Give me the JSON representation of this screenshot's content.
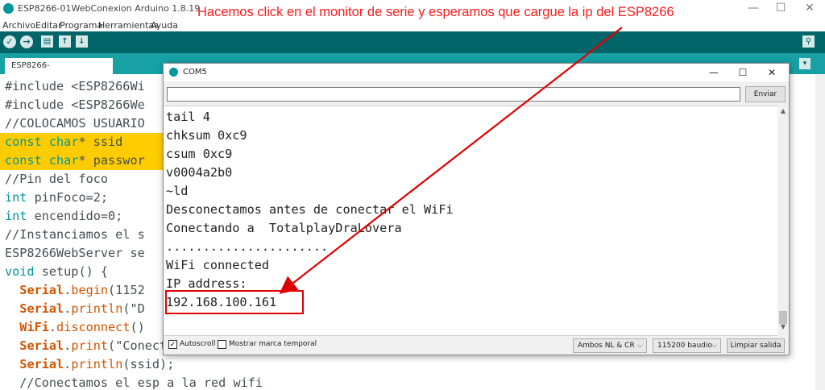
{
  "window": {
    "title": "ESP8266-01WebConexion Arduino 1.8.19"
  },
  "window_controls": {
    "minimize": "—",
    "maximize": "☐",
    "close": "✕"
  },
  "menu": [
    "Archivo",
    "Editar",
    "Programa",
    "Herramientas",
    "Ayuda"
  ],
  "toolbar": {
    "verify": "✓",
    "upload": "→",
    "new": "▤",
    "open": "↑",
    "save": "↓",
    "serial_monitor": "⚲"
  },
  "tab": {
    "label": "ESP8266-01WebConexion",
    "menu": "▾"
  },
  "code": [
    [
      {
        "t": "#include <ESP8266Wi"
      }
    ],
    [
      {
        "t": "#include <ESP8266We"
      }
    ],
    [
      {
        "t": "//COLOCAMOS USUARIO"
      }
    ],
    [
      {
        "t": "const char",
        "c": "kw-type"
      },
      {
        "t": "* ssid"
      }
    ],
    [
      {
        "t": "const char",
        "c": "kw-type"
      },
      {
        "t": "* passwor"
      }
    ],
    [
      {
        "t": "//Pin del foco"
      }
    ],
    [
      {
        "t": "int",
        "c": "kw-type"
      },
      {
        "t": " pinFoco=2;"
      }
    ],
    [
      {
        "t": "int",
        "c": "kw-type"
      },
      {
        "t": " encendido=0;"
      }
    ],
    [
      {
        "t": "//Instanciamos el s"
      }
    ],
    [
      {
        "t": "ESP8266WebServer se"
      }
    ],
    [
      {
        "t": "void",
        "c": "kw-type"
      },
      {
        "t": " setup() {"
      }
    ],
    [
      {
        "t": "  "
      },
      {
        "t": "Serial",
        "c": "kw-obj"
      },
      {
        "t": "."
      },
      {
        "t": "begin",
        "c": "kw-fn"
      },
      {
        "t": "(1152"
      }
    ],
    [
      {
        "t": "  "
      },
      {
        "t": "Serial",
        "c": "kw-obj"
      },
      {
        "t": "."
      },
      {
        "t": "println",
        "c": "kw-fn"
      },
      {
        "t": "(\"D"
      }
    ],
    [
      {
        "t": "  "
      },
      {
        "t": "WiFi",
        "c": "kw-obj"
      },
      {
        "t": "."
      },
      {
        "t": "disconnect",
        "c": "kw-fn"
      },
      {
        "t": "()"
      }
    ],
    [
      {
        "t": "  "
      },
      {
        "t": "Serial",
        "c": "kw-obj"
      },
      {
        "t": "."
      },
      {
        "t": "print",
        "c": "kw-fn"
      },
      {
        "t": "(\"Conectando a \");"
      }
    ],
    [
      {
        "t": "  "
      },
      {
        "t": "Serial",
        "c": "kw-obj"
      },
      {
        "t": "."
      },
      {
        "t": "println",
        "c": "kw-fn"
      },
      {
        "t": "(ssid);"
      }
    ],
    [
      {
        "t": "  //Conectamos el esp a la red wifi"
      }
    ]
  ],
  "highlighted_lines": [
    3,
    4
  ],
  "serial": {
    "title": "COM5",
    "send_value": "",
    "send_label": "Enviar",
    "output": [
      "tail 4",
      "chksum 0xc9",
      "csum 0xc9",
      "v0004a2b0",
      "~ld",
      "Desconectamos antes de conectar el WiFi",
      "Conectando a  TotalplayDraLovera",
      "......................",
      "WiFi connected",
      "IP address:",
      "192.168.100.161"
    ],
    "autoscroll_label": "Autoscroll",
    "autoscroll_checked": true,
    "autoscroll_mark": "✓",
    "timestamp_label": "Mostrar marca temporal",
    "timestamp_checked": false,
    "line_ending": "Ambos NL & CR",
    "baud": "115200 baudio",
    "clear_label": "Limpiar salida",
    "scroll_up": "▲",
    "scroll_down": "▼",
    "chevron": "⌵"
  },
  "annotation": {
    "text": "Hacemos click en el monitor de serie y esperamos que cargue la ip del ESP8266",
    "color": "#ff1a1a"
  },
  "colors": {
    "toolbar": "#006468",
    "tabbar": "#17a1a5",
    "highlight": "#ffcc00",
    "keyword": "#00979c",
    "object": "#d35400"
  }
}
